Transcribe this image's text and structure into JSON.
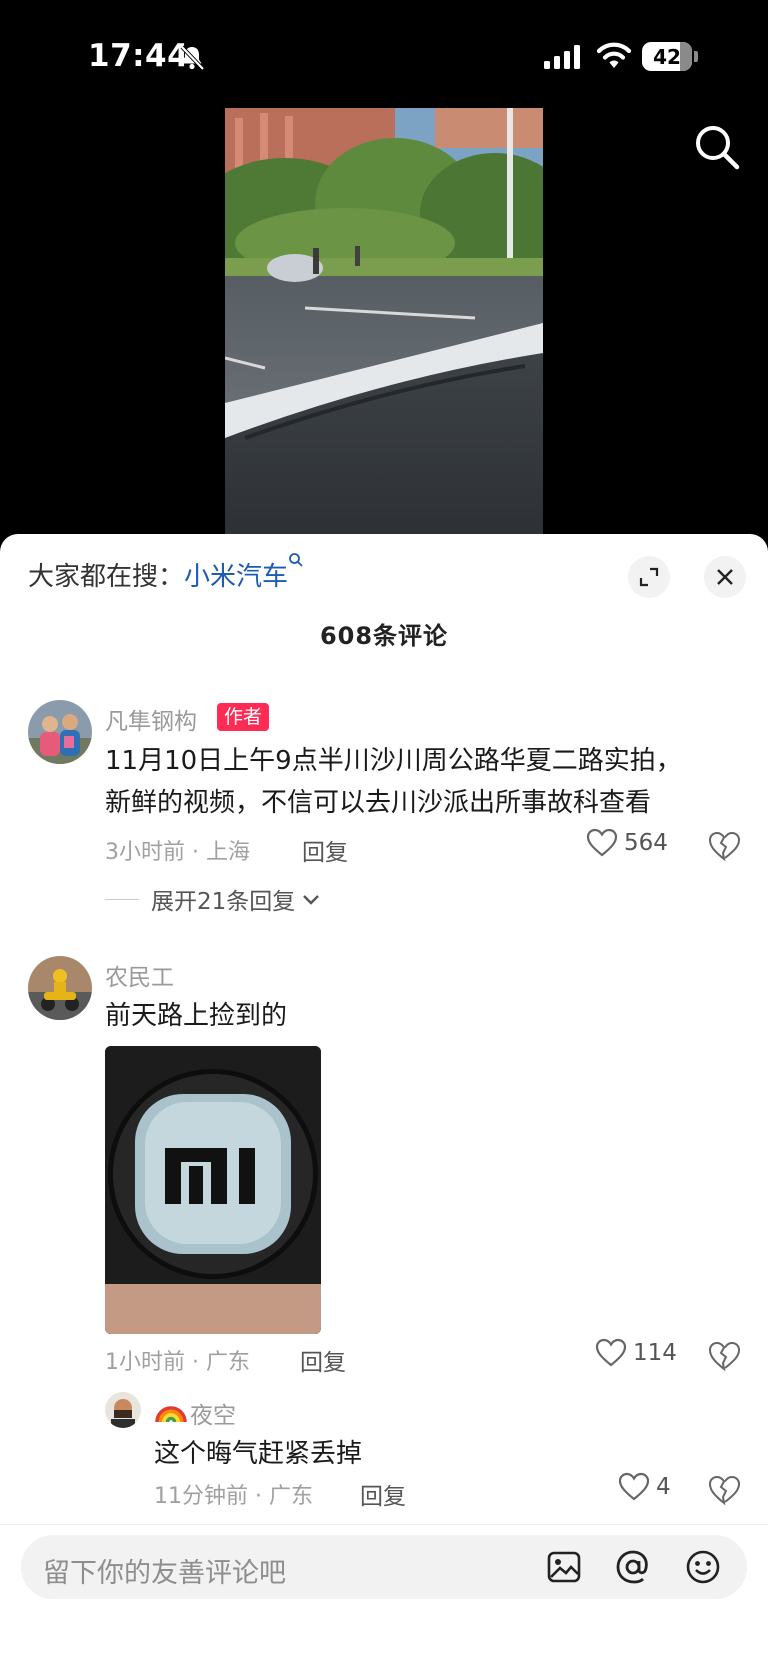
{
  "status_bar": {
    "time": "17:44",
    "battery": "42",
    "icons": [
      "bell-slash-icon",
      "signal-icon",
      "wifi-icon",
      "battery-icon"
    ]
  },
  "header": {
    "search_icon": "search-icon"
  },
  "sheet": {
    "trend_prefix": "大家都在搜：",
    "trend_keyword": "小米汽车",
    "comment_count": "608条评论",
    "icons": [
      "expand-icon",
      "close-icon"
    ]
  },
  "comments": [
    {
      "username": "凡隼钢构",
      "badge": "作者",
      "text_lines": [
        "11月10日上午9点半川沙川周公路华夏二路实拍，",
        "新鲜的视频，不信可以去川沙派出所事故科查看"
      ],
      "time": "3小时前 · 上海",
      "reply_label": "回复",
      "likes": "564",
      "expand_replies": "展开21条回复"
    },
    {
      "username": "农民工",
      "text": "前天路上捡到的",
      "time": "1小时前 · 广东",
      "reply_label": "回复",
      "likes": "114",
      "reply": {
        "username": "夜空",
        "text": "这个晦气赶紧丢掉",
        "time": "11分钟前 · 广东",
        "reply_label": "回复",
        "likes": "4"
      }
    }
  ],
  "input_bar": {
    "placeholder": "留下你的友善评论吧",
    "icons": [
      "image-icon",
      "at-icon",
      "emoji-icon"
    ]
  },
  "colors": {
    "accent": "#fe2c55",
    "link": "#1d5bb8",
    "sheet_bg": "#ffffff"
  }
}
